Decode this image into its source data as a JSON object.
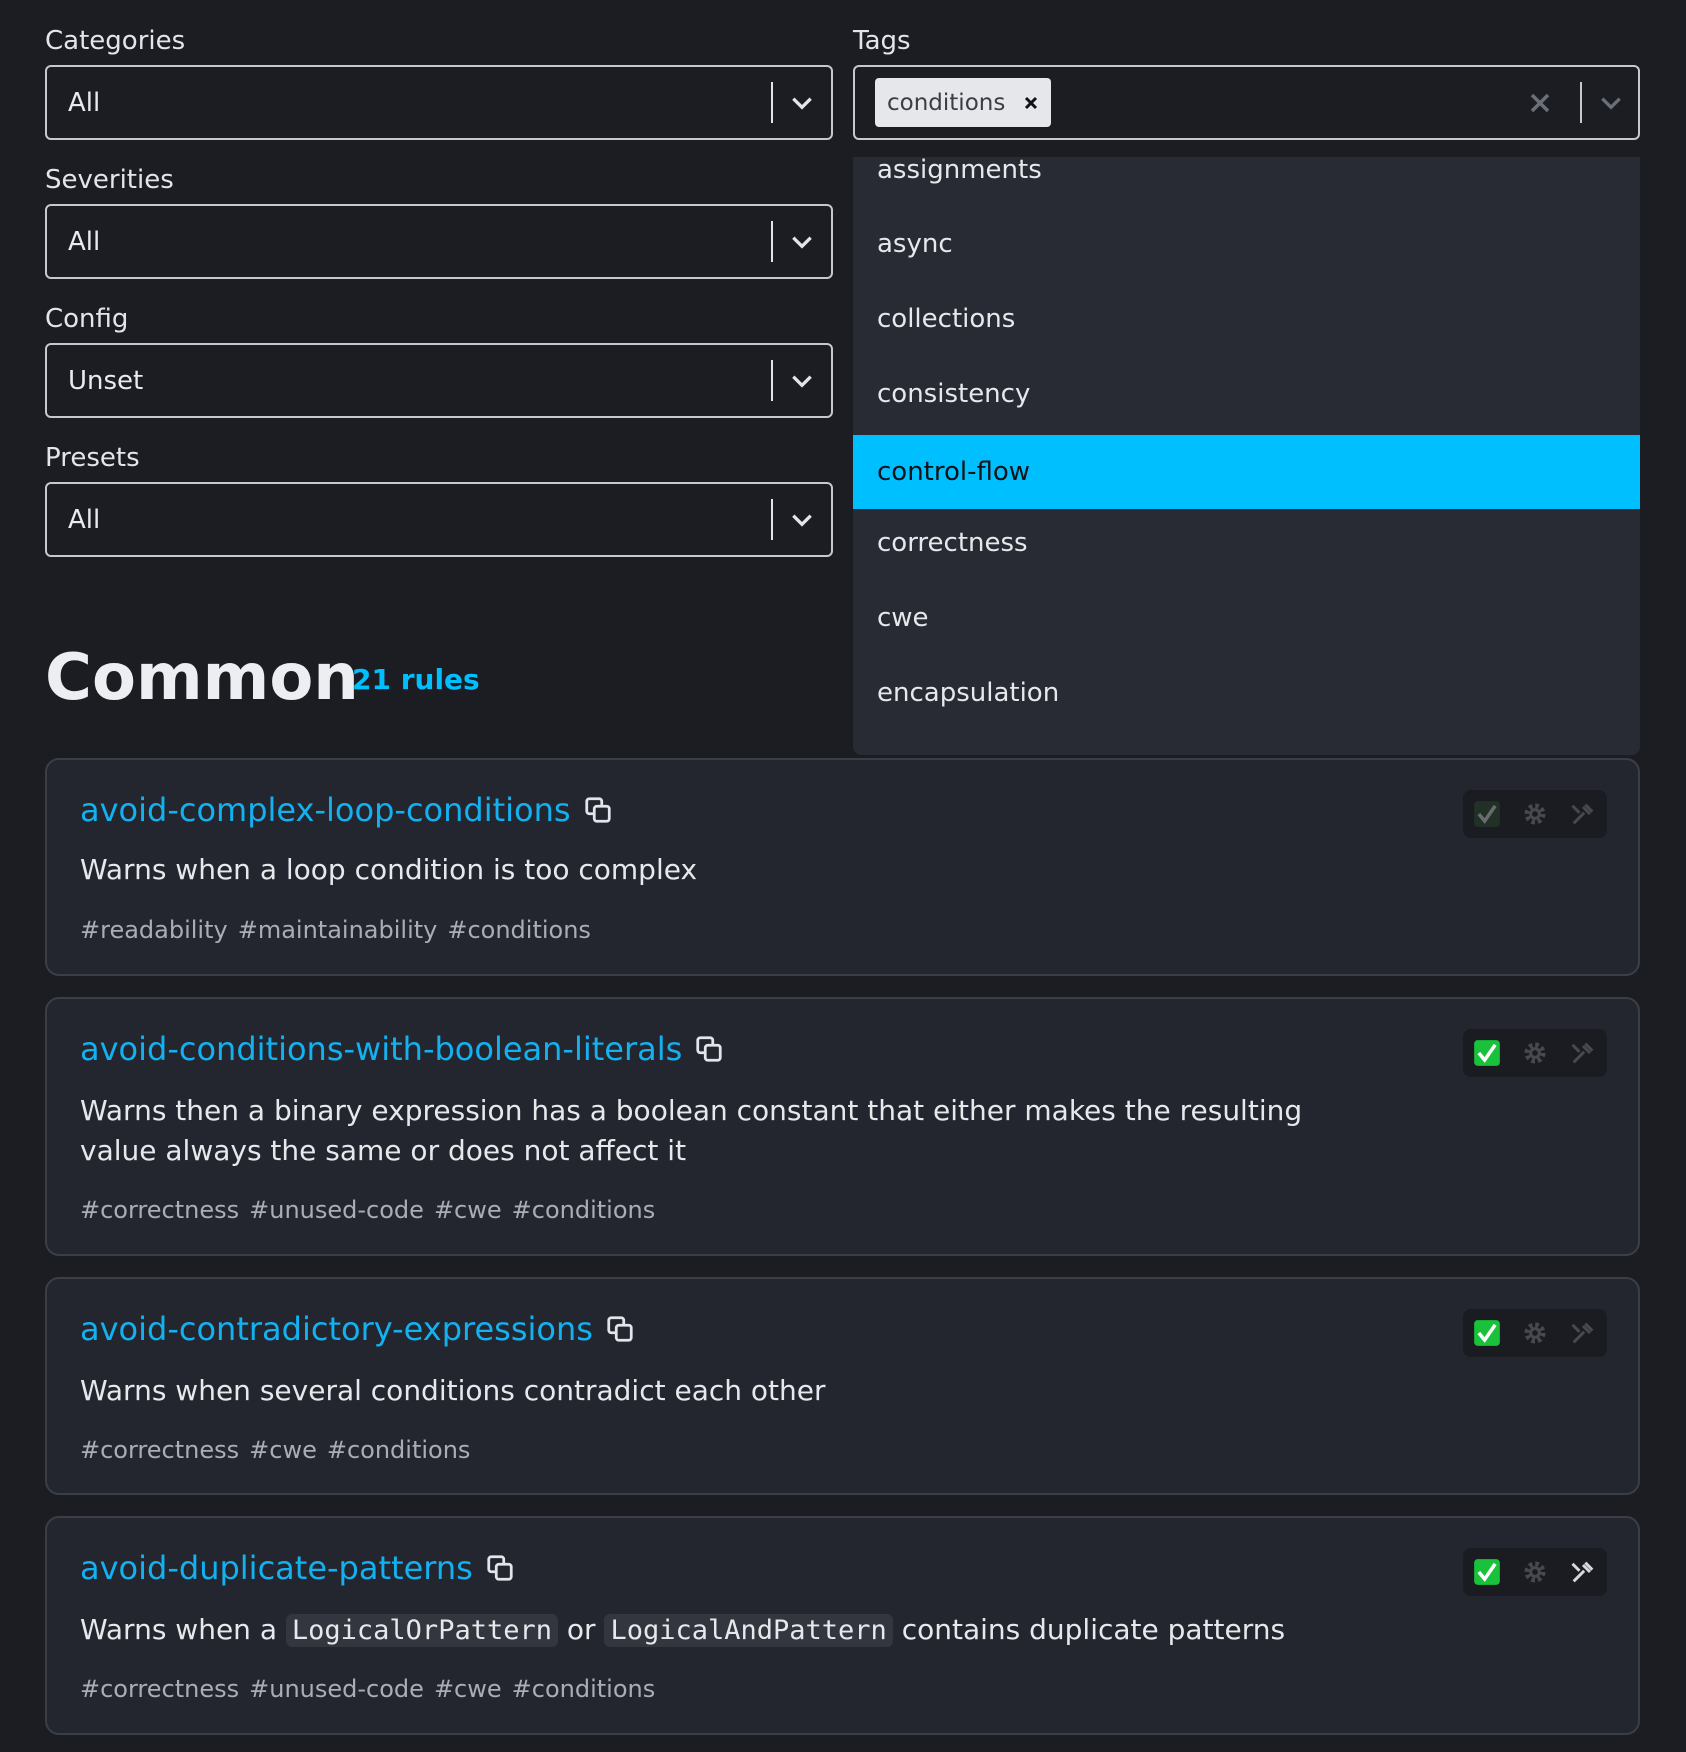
{
  "filters": {
    "categories": {
      "label": "Categories",
      "value": "All"
    },
    "severities": {
      "label": "Severities",
      "value": "All"
    },
    "config": {
      "label": "Config",
      "value": "Unset"
    },
    "presets": {
      "label": "Presets",
      "value": "All"
    },
    "tags": {
      "label": "Tags",
      "selected": [
        "conditions"
      ],
      "options": [
        "assignments",
        "async",
        "collections",
        "consistency",
        "control-flow",
        "correctness",
        "cwe",
        "encapsulation"
      ],
      "highlighted": "control-flow"
    }
  },
  "section": {
    "title": "Common",
    "count": "21 rules"
  },
  "rules": [
    {
      "name": "avoid-complex-loop-conditions",
      "description": "Warns when a loop condition is too complex",
      "tags": [
        "#readability",
        "#maintainability",
        "#conditions"
      ],
      "recommended": false,
      "configurable": false,
      "fixable": false
    },
    {
      "name": "avoid-conditions-with-boolean-literals",
      "description_line1": "Warns then a binary expression has a boolean constant that either makes the resulting",
      "description_line2": "value always the same or does not affect it",
      "tags": [
        "#correctness",
        "#unused-code",
        "#cwe",
        "#conditions"
      ],
      "recommended": true,
      "configurable": false,
      "fixable": false
    },
    {
      "name": "avoid-contradictory-expressions",
      "description": "Warns when several conditions contradict each other",
      "tags": [
        "#correctness",
        "#cwe",
        "#conditions"
      ],
      "recommended": true,
      "configurable": false,
      "fixable": false
    },
    {
      "name": "avoid-duplicate-patterns",
      "description_parts": [
        "Warns when a",
        "LogicalOrPattern",
        "or",
        "LogicalAndPattern",
        "contains duplicate patterns"
      ],
      "tags": [
        "#correctness",
        "#unused-code",
        "#cwe",
        "#conditions"
      ],
      "recommended": true,
      "configurable": false,
      "fixable": true
    }
  ],
  "icons": {
    "chevron": "chevron-down-icon",
    "clear": "close-icon",
    "copy": "copy-icon",
    "recommended": "check-box-icon",
    "configurable": "gear-icon",
    "fixable": "wrench-icon"
  },
  "colors": {
    "background": "#1b1d23",
    "card": "#23262e",
    "accent": "#00bfff",
    "link": "#13b1f0",
    "check": "#19c23a"
  }
}
